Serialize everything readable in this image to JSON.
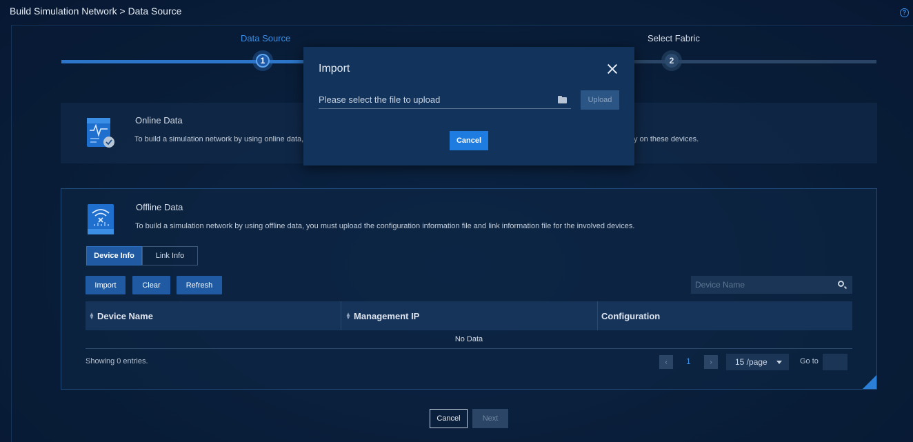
{
  "breadcrumb": "Build Simulation Network > Data Source",
  "stepper": {
    "step1": {
      "label": "Data Source",
      "number": "1"
    },
    "step2": {
      "label": "Select Fabric",
      "number": "2"
    }
  },
  "online": {
    "title": "Online Data",
    "desc_left": "To build a simulation network by using online data, r",
    "desc_right": "ctly on these devices."
  },
  "offline": {
    "title": "Offline Data",
    "desc": "To build a simulation network by using offline data, you must upload the configuration information file and link information file for the involved devices.",
    "tabs": [
      "Device Info",
      "Link Info"
    ],
    "buttons": {
      "import": "Import",
      "clear": "Clear",
      "refresh": "Refresh"
    },
    "search_placeholder": "Device Name",
    "columns": [
      "Device Name",
      "Management IP",
      "Configuration"
    ],
    "empty": "No Data",
    "showing": "Showing 0 entries.",
    "pagination": {
      "page": "1",
      "page_size": "15 /page",
      "goto": "Go to"
    }
  },
  "footer": {
    "cancel": "Cancel",
    "next": "Next"
  },
  "modal": {
    "title": "Import",
    "file_placeholder": "Please select the file to upload",
    "upload": "Upload",
    "cancel": "Cancel"
  }
}
